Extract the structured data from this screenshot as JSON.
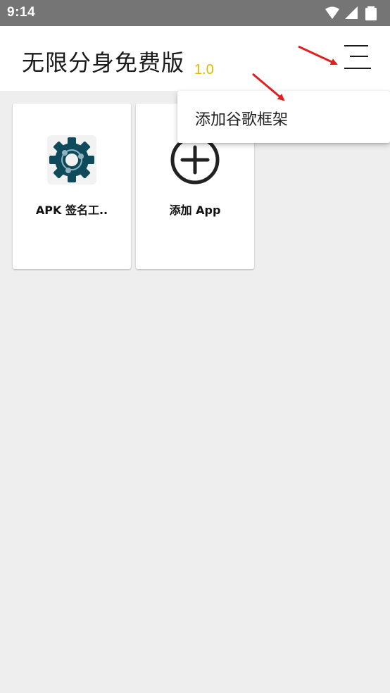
{
  "status_bar": {
    "time": "9:14",
    "icons": [
      "wifi-icon",
      "cell-signal-icon",
      "battery-icon"
    ]
  },
  "app_bar": {
    "title": "无限分身免费版",
    "version": "1.0",
    "menu_icon": "hamburger-menu-icon"
  },
  "apps": [
    {
      "label": "APK 签名工..",
      "icon": "gear-app-icon"
    },
    {
      "label": "添加 App",
      "icon": "add-circle-icon"
    }
  ],
  "popup_menu": {
    "items": [
      {
        "label": "添加谷歌框架"
      }
    ]
  },
  "colors": {
    "status_bar": "#757575",
    "app_bar": "#ffffff",
    "background": "#eeeeee",
    "version_accent": "#e6b800",
    "annotation_arrow": "#e02020",
    "gear_icon": "#0e4a5c"
  }
}
